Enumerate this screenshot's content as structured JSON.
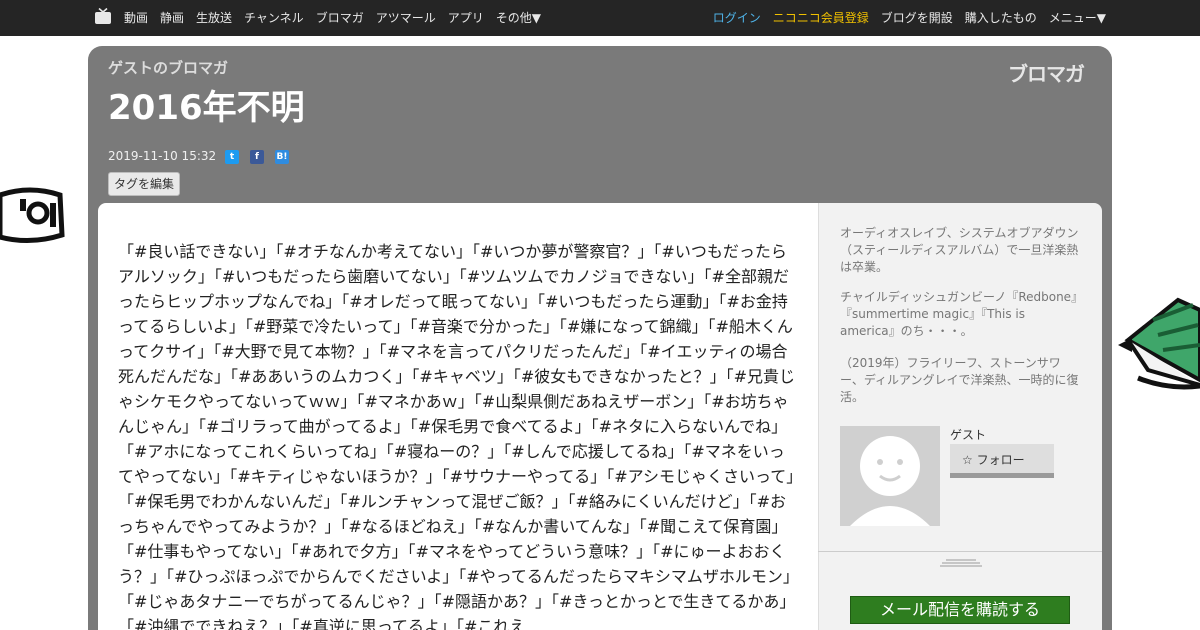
{
  "nav": {
    "left_items": [
      "動画",
      "静画",
      "生放送",
      "チャンネル",
      "ブロマガ",
      "アツマール",
      "アプリ",
      "その他▼"
    ],
    "login": "ログイン",
    "premium": "ニコニコ会員登録",
    "open_blog": "ブログを開設",
    "purchased": "購入したもの",
    "menu": "メニュー▼"
  },
  "header": {
    "blog_name": "ゲストのブロマガ",
    "logo": "ブロマガ",
    "title": "2016年不明",
    "date": "2019-11-10 15:32",
    "share": {
      "twitter": "t",
      "facebook": "f",
      "hatena": "B!"
    },
    "tag_edit": "タグを編集"
  },
  "article": {
    "body": "「#良い話できない」「#オチなんか考えてない」「#いつか夢が警察官？」「#いつもだったらアルソック」「#いつもだったら歯磨いてない」「#ツムツムでカノジョできない」「#全部親だったらヒップホップなんでね」「#オレだって眠ってない」「#いつもだったら運動」「#お金持ってるらしいよ」「#野菜で冷たいって」「#音楽で分かった」「#嫌になって錦織」「#船木くんってクサイ」「#大野で見て本物？」「#マネを言ってパクリだったんだ」「#イエッティの場合死んだんだな」「#ああいうのムカつく」「#キャベツ」「#彼女もできなかったと？」「#兄貴じゃシケモクやってないってｗｗ」「#マネかあｗ」「#山梨県側だあねえザーボン」「#お坊ちゃんじゃん」「#ゴリラって曲がってるよ」「#保毛男で食べてるよ」「#ネタに入らないんでね」「#アホになってこれくらいってね」「#寝ねーの？」「#しんで応援してるね」「#マネをいってやってない」「#キティじゃないほうか？」「#サウナーやってる」「#アシモじゃくさいって」「#保毛男でわかんないんだ」「#ルンチャンって混ぜご飯？」「#絡みにくいんだけど」「#おっちゃんでやってみようか？」「#なるほどねえ」「#なんか書いてんな」「#聞こえて保育園」「#仕事もやってない」「#あれで夕方」「#マネをやってどういう意味？」「#にゅーよおおくう？」「#ひっぷほっぷでからんでくださいよ」「#やってるんだったらマキシマムザホルモン」「#じゃあタナニーでちがってるんじゃ？」「#隠語かあ？」「#きっとかっとで生きてるかあ」「#沖縄でできねえ？」「#真逆に思ってるよ」「#これえ"
  },
  "sidebar": {
    "para1": "オーディオスレイブ、システムオブアダウン（スティールディスアルバム）で一旦洋楽熱は卒業。",
    "para2": "チャイルディッシュガンビーノ『Redbone』『summertime magic』『This is america』のち・・・。",
    "para3": "（2019年）フライリーフ、ストーンサワー、ディルアングレイで洋楽熱、一時的に復活。",
    "user_name": "ゲスト",
    "follow": "フォロー",
    "subscribe": "メール配信を購読する"
  }
}
